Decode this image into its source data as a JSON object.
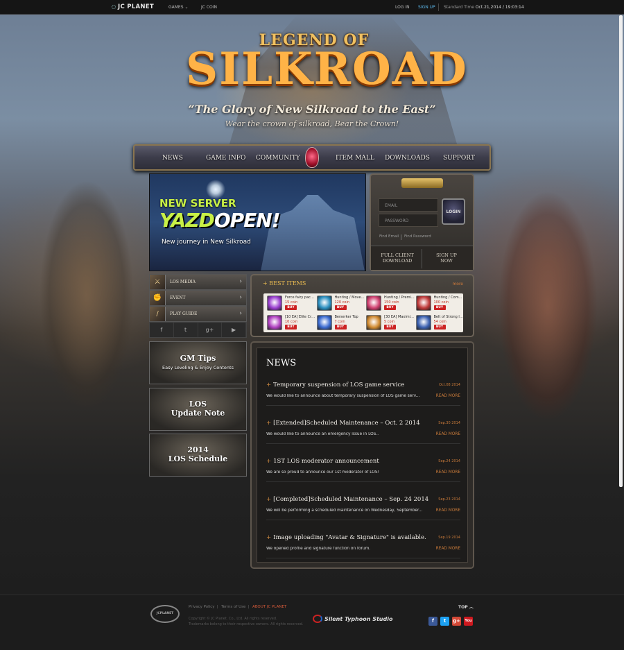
{
  "topbar": {
    "brand": "JC PLANET",
    "games": "GAMES",
    "jc_coin": "JC COIN",
    "login": "LOG IN",
    "signup": "SIGN UP",
    "standard_time_label": "Standard Time",
    "standard_time_value": "Oct.21,2014 / 19:03:14"
  },
  "hero": {
    "logo_small": "LEGEND OF",
    "logo_big": "SILKROAD",
    "tagline": "“The Glory of New Silkroad to the East”",
    "subtagline": "Wear the crown of silkroad, Bear the Crown!"
  },
  "nav": [
    "NEWS",
    "GAME INFO",
    "COMMUNITY",
    "ITEM MALL",
    "DOWNLOADS",
    "SUPPORT"
  ],
  "banner": {
    "new_server": "NEW SERVER",
    "yazd": "YAZD",
    "open": "OPEN!",
    "journey": "New journey in New Silkroad"
  },
  "login": {
    "email_placeholder": "EMAIL",
    "password_placeholder": "PASSWORD",
    "login_button": "LOGIN",
    "find_email": "Find Email",
    "find_password": "Find Password",
    "full_client_line1": "FULL CLIENT",
    "full_client_line2": "DOWNLOAD",
    "signup_line1": "SIGN UP",
    "signup_line2": "NOW"
  },
  "side_menu": [
    {
      "label": "LOS MEDIA",
      "icon": "sword-icon"
    },
    {
      "label": "EVENT",
      "icon": "fist-icon"
    },
    {
      "label": "PLAY GUIDE",
      "icon": "staff-icon"
    }
  ],
  "social": [
    "f",
    "t",
    "g+",
    "▶"
  ],
  "promos": {
    "gm_title": "GM Tips",
    "gm_sub": "Easy Leveling & Enjoy Contents",
    "update_l1": "LOS",
    "update_l2": "Update Note",
    "sched_l1": "2014",
    "sched_l2": "LOS Schedule"
  },
  "best_items": {
    "title": "BEST ITEMS",
    "more": "more",
    "buy": "BUY",
    "items": [
      {
        "name": "Force fairy pack...",
        "price": "15 coin",
        "color": "#9a3fd0"
      },
      {
        "name": "Hunting / Move...",
        "price": "120 coin",
        "color": "#2a8fc0"
      },
      {
        "name": "Hunting / Premi...",
        "price": "150 coin",
        "color": "#d04070"
      },
      {
        "name": "Hunting / Com...",
        "price": "100 coin",
        "color": "#c03a3a"
      },
      {
        "name": "[10 EA] Elite Cry...",
        "price": "10 coin",
        "color": "#b040c0"
      },
      {
        "name": "Berserker Top",
        "price": "7 coin",
        "color": "#3a6ad0"
      },
      {
        "name": "[30 EA] Maximiz...",
        "price": "5 coin",
        "color": "#d08a30"
      },
      {
        "name": "Belt of Strong l...",
        "price": "54 coin",
        "color": "#3a60b0"
      }
    ]
  },
  "news": {
    "heading": "NEWS",
    "read_more": "READ MORE",
    "items": [
      {
        "title": "Temporary suspension of LOS game service",
        "date": "Oct.08 2014",
        "desc": "We would like to announce about temporary suspension of LOS game serv..."
      },
      {
        "title": "[Extended]Scheduled Maintenance – Oct. 2 2014",
        "date": "Sep.30 2014",
        "desc": "We would like to announce an emergency issue in LOS.."
      },
      {
        "title": "1ST LOS moderator announcement",
        "date": "Sep.24 2014",
        "desc": "We are so proud to announce our 1st moderator of LOS!"
      },
      {
        "title": "[Completed]Scheduled Maintenance – Sep. 24 2014",
        "date": "Sep.23 2014",
        "desc": "We will be performing a scheduled maintenance on Wednesday, September..."
      },
      {
        "title": "Image uploading \"Avatar & Signature\" is available.",
        "date": "Sep.19 2014",
        "desc": "We opened profile and signature function on forum."
      }
    ]
  },
  "footer": {
    "logo": "JCPLANET",
    "privacy": "Privacy Policy",
    "terms": "Terms of Use",
    "about": "ABOUT JC PLANET",
    "copyright": "Copyright © JC Planet. Co., Ltd. All rights reserved.",
    "trademarks": "Trademarks belong to their respective owners. All rights reserved.",
    "studio": "Silent Typhoon Studio",
    "top": "TOP",
    "social": [
      {
        "label": "f",
        "color": "#3b5998"
      },
      {
        "label": "t",
        "color": "#1da1f2"
      },
      {
        "label": "g+",
        "color": "#d34836"
      },
      {
        "label": "You",
        "color": "#cc181e"
      }
    ]
  }
}
